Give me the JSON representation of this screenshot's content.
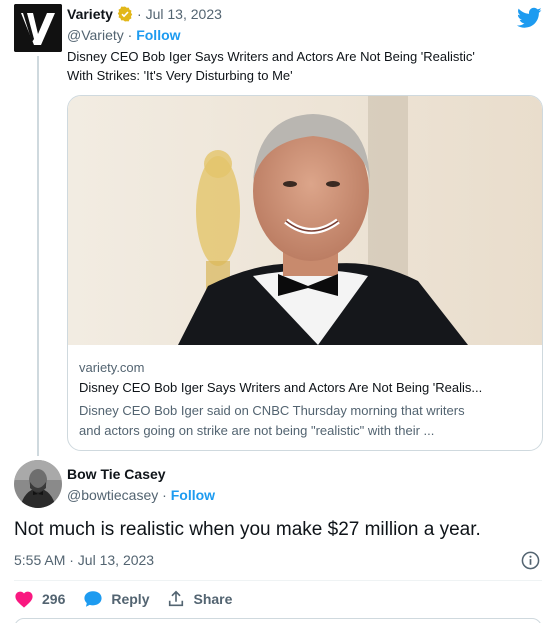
{
  "tweet": {
    "author_name": "Variety",
    "date": "Jul 13, 2023",
    "separator": "·",
    "handle": "@Variety",
    "follow_label": "Follow",
    "text_line1": "Disney CEO Bob Iger Says Writers and Actors Are Not Being 'Realistic'",
    "text_line2": "With Strikes: 'It's Very Disturbing to Me'",
    "card": {
      "domain": "variety.com",
      "title": "Disney CEO Bob Iger Says Writers and Actors Are Not Being 'Realis...",
      "description_line1": "Disney CEO Bob Iger said on CNBC Thursday morning that writers",
      "description_line2": "and actors going on strike are not being \"realistic\" with their ..."
    }
  },
  "reply": {
    "author_name": "Bow Tie Casey",
    "handle": "@bowtiecasey",
    "separator": "·",
    "follow_label": "Follow",
    "text": "Not much is realistic when you make $27 million a year.",
    "timestamp": "5:55 AM · Jul 13, 2023",
    "like_count": "296",
    "reply_label": "Reply",
    "share_label": "Share"
  },
  "colors": {
    "twitter_blue": "#1d9bf0",
    "like_red": "#f91880",
    "verified_gold": "#e2b719"
  },
  "icons": [
    "variety-logo",
    "verified-badge-icon",
    "twitter-bird-icon",
    "info-icon",
    "heart-icon",
    "reply-bubble-icon",
    "share-icon"
  ]
}
